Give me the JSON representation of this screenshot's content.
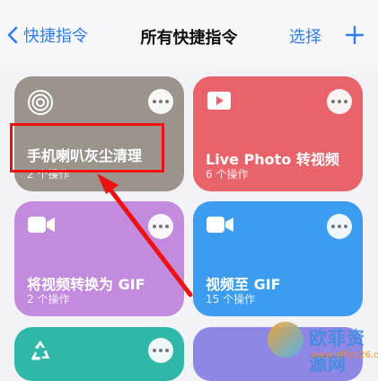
{
  "nav": {
    "back_label": "快捷指令",
    "title": "所有快捷指令",
    "select_label": "选择"
  },
  "cards": [
    {
      "title": "手机喇叭灰尘清理",
      "subtitle": "2 个操作",
      "icon": "radio-wave-icon",
      "color": "#9b948d"
    },
    {
      "title": "Live Photo 转视频",
      "subtitle": "6 个操作",
      "icon": "play-icon",
      "color": "#e9636b"
    },
    {
      "title": "将视频转换为 GIF",
      "subtitle": "2 个操作",
      "icon": "video-camera-icon",
      "color": "#c38bdd"
    },
    {
      "title": "视频至 GIF",
      "subtitle": "15 个操作",
      "icon": "video-camera-icon",
      "color": "#3c9cf0"
    },
    {
      "title": "",
      "subtitle": "",
      "icon": "recycle-icon",
      "color": "#2fb8a8"
    },
    {
      "title": "",
      "subtitle": "",
      "icon": "",
      "color": "#8f87e6"
    }
  ],
  "watermark": {
    "text": "欧菲资源网",
    "url": "www.office26.com"
  },
  "colors": {
    "accent": "#2f7cf6",
    "highlight": "#ee1111"
  }
}
